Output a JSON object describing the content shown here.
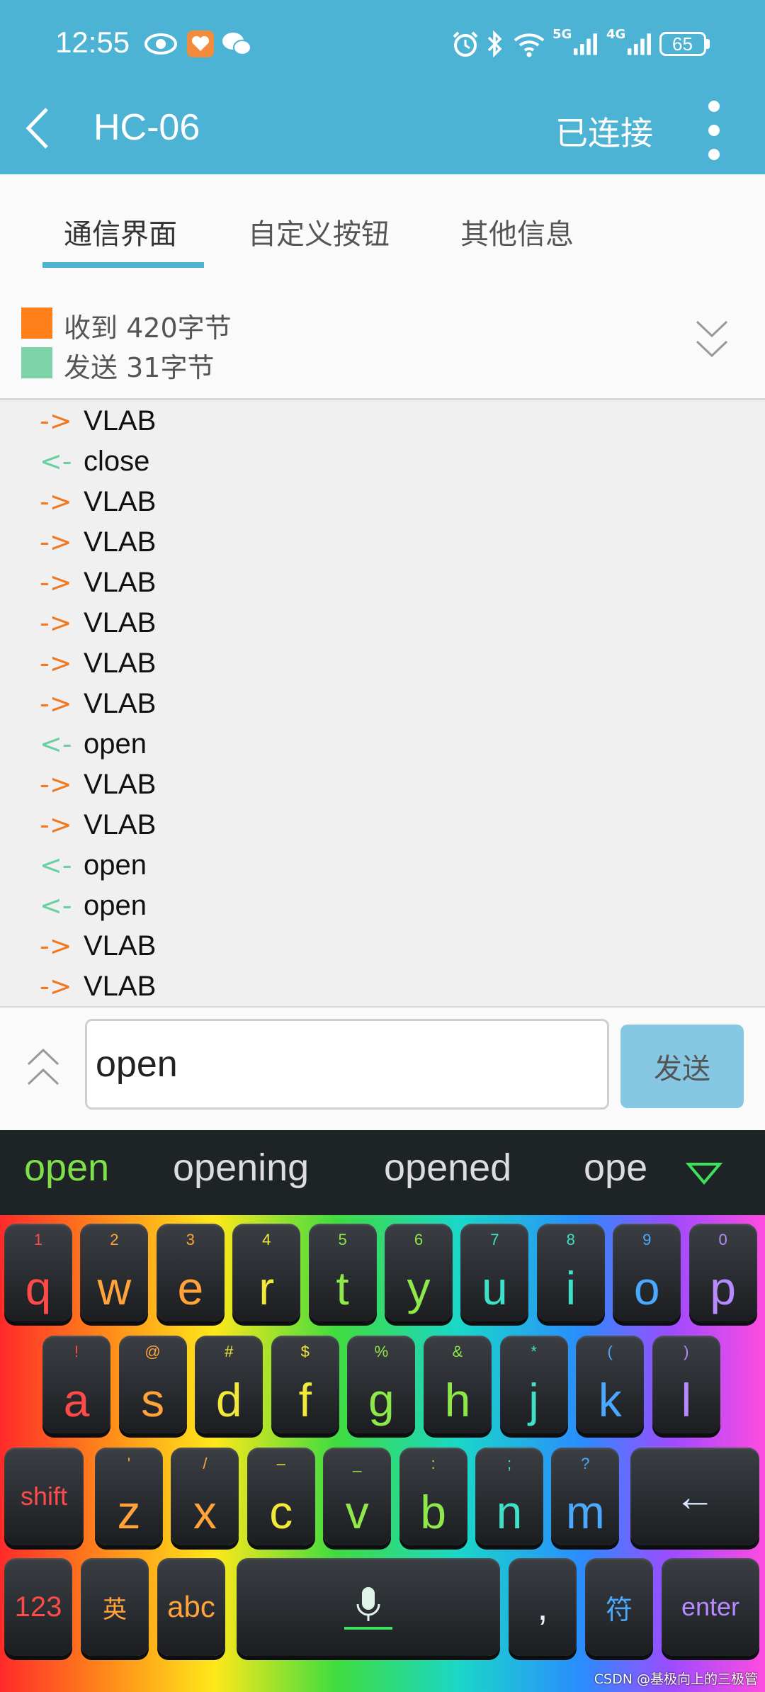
{
  "status_bar": {
    "time": "12:55",
    "network_labels": [
      "5G",
      "4G"
    ],
    "battery": "65"
  },
  "app_bar": {
    "title": "HC-06",
    "connection_status": "已连接"
  },
  "tabs": [
    {
      "label": "通信界面",
      "active": true
    },
    {
      "label": "自定义按钮",
      "active": false
    },
    {
      "label": "其他信息",
      "active": false
    }
  ],
  "counters": {
    "received": {
      "label": "收到",
      "value": "420字节",
      "color": "#ff7f1a"
    },
    "sent": {
      "label": "发送",
      "value": "31字节",
      "color": "#7ed3a8"
    }
  },
  "arrows": {
    "rx": "->",
    "tx": "<-",
    "rx_color": "#f07a22",
    "tx_color": "#6bd0a0"
  },
  "log": [
    {
      "dir": "rx",
      "text": "VLAB"
    },
    {
      "dir": "tx",
      "text": "close"
    },
    {
      "dir": "rx",
      "text": "VLAB"
    },
    {
      "dir": "rx",
      "text": "VLAB"
    },
    {
      "dir": "rx",
      "text": "VLAB"
    },
    {
      "dir": "rx",
      "text": "VLAB"
    },
    {
      "dir": "rx",
      "text": "VLAB"
    },
    {
      "dir": "rx",
      "text": "VLAB"
    },
    {
      "dir": "tx",
      "text": "open"
    },
    {
      "dir": "rx",
      "text": "VLAB"
    },
    {
      "dir": "rx",
      "text": "VLAB"
    },
    {
      "dir": "tx",
      "text": "open"
    },
    {
      "dir": "tx",
      "text": "open"
    },
    {
      "dir": "rx",
      "text": "VLAB"
    },
    {
      "dir": "rx",
      "text": "VLAB"
    }
  ],
  "input": {
    "value": "open",
    "send_label": "发送"
  },
  "keyboard": {
    "suggestions": [
      "open",
      "opening",
      "opened",
      "ope"
    ],
    "row1": [
      {
        "main": "q",
        "sub": "1"
      },
      {
        "main": "w",
        "sub": "2"
      },
      {
        "main": "e",
        "sub": "3"
      },
      {
        "main": "r",
        "sub": "4"
      },
      {
        "main": "t",
        "sub": "5"
      },
      {
        "main": "y",
        "sub": "6"
      },
      {
        "main": "u",
        "sub": "7"
      },
      {
        "main": "i",
        "sub": "8"
      },
      {
        "main": "o",
        "sub": "9"
      },
      {
        "main": "p",
        "sub": "0"
      }
    ],
    "row2": [
      {
        "main": "a",
        "sub": "!"
      },
      {
        "main": "s",
        "sub": "@"
      },
      {
        "main": "d",
        "sub": "#"
      },
      {
        "main": "f",
        "sub": "$"
      },
      {
        "main": "g",
        "sub": "%"
      },
      {
        "main": "h",
        "sub": "&"
      },
      {
        "main": "j",
        "sub": "*"
      },
      {
        "main": "k",
        "sub": "("
      },
      {
        "main": "l",
        "sub": ")"
      }
    ],
    "row3": [
      {
        "main": "z",
        "sub": "'"
      },
      {
        "main": "x",
        "sub": "/"
      },
      {
        "main": "c",
        "sub": "–"
      },
      {
        "main": "v",
        "sub": "_"
      },
      {
        "main": "b",
        "sub": ":"
      },
      {
        "main": "n",
        "sub": ";"
      },
      {
        "main": "m",
        "sub": "?"
      }
    ],
    "shift_label": "shift",
    "backspace_label": "←",
    "num_label": "123",
    "lang_label": "英",
    "abc_label": "abc",
    "punct_label": ",",
    "symbol_label": "符",
    "enter_label": "enter"
  },
  "watermark": "CSDN @基极向上的三极管"
}
